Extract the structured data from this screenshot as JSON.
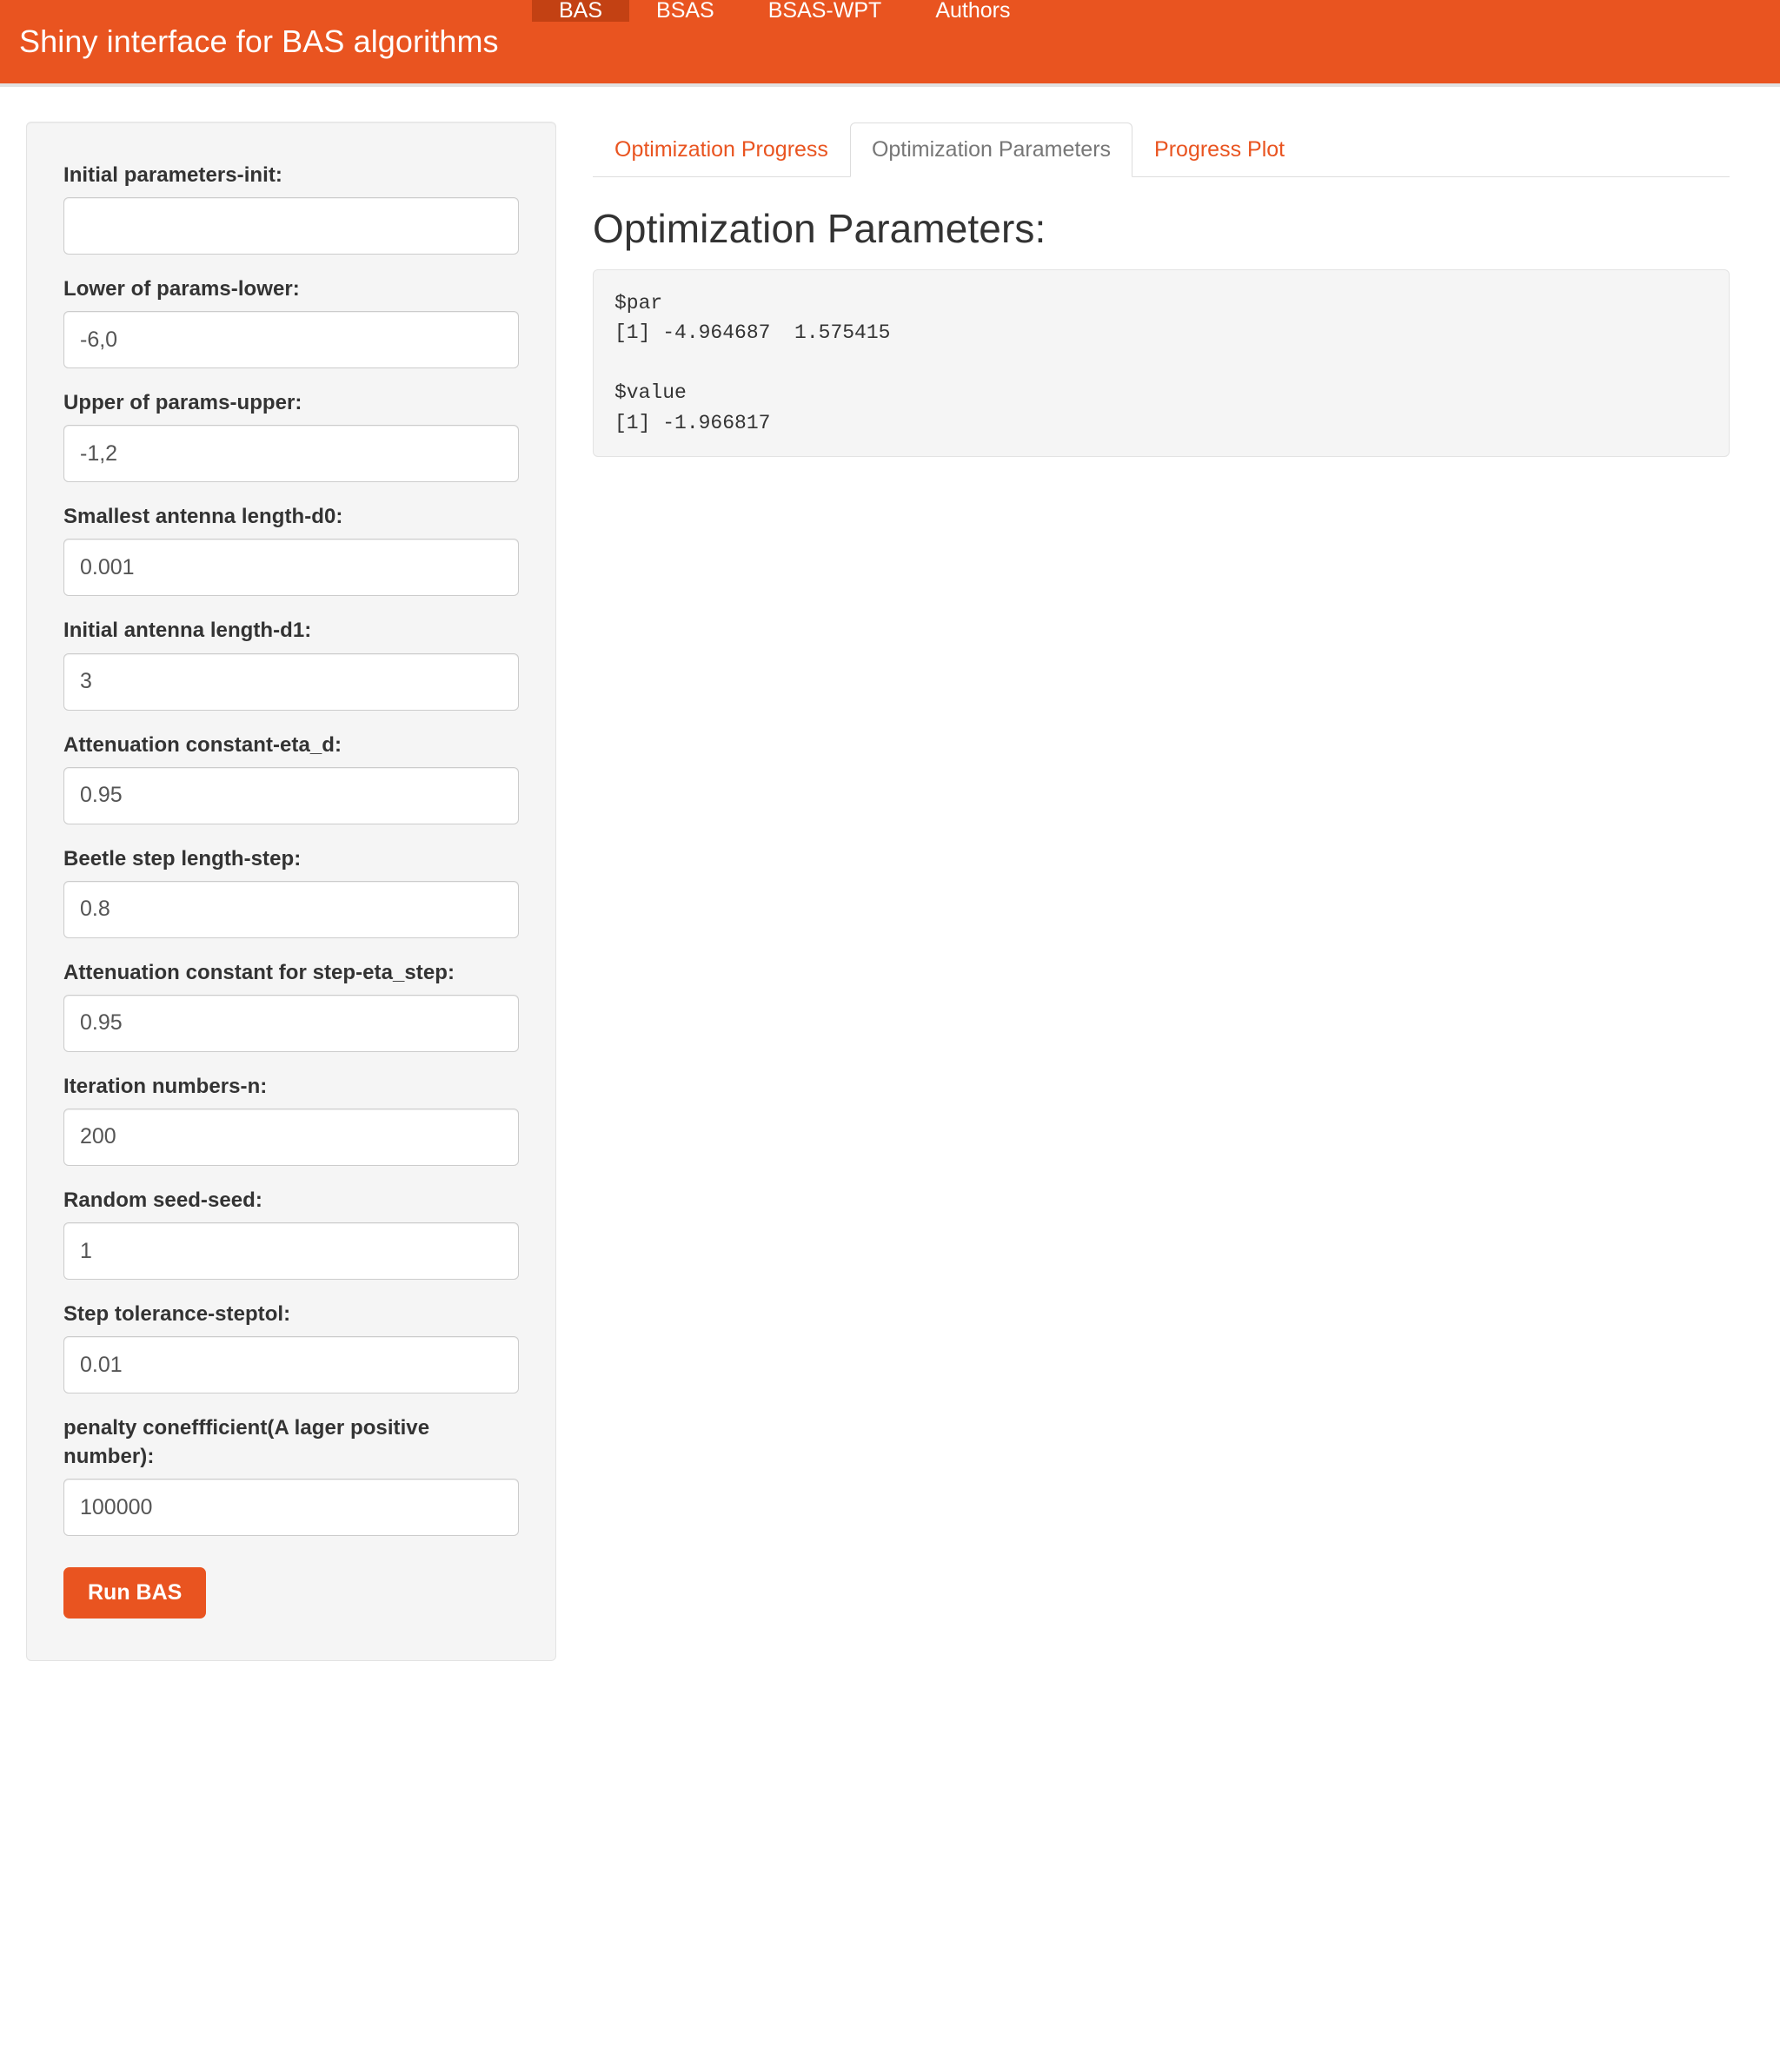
{
  "navbar": {
    "brand": "Shiny interface for BAS algorithms",
    "items": [
      {
        "label": "BAS",
        "active": true
      },
      {
        "label": "BSAS",
        "active": false
      },
      {
        "label": "BSAS-WPT",
        "active": false
      },
      {
        "label": "Authors",
        "active": false
      }
    ],
    "background_color": "#e95420",
    "active_color": "#c34113"
  },
  "sidebar": {
    "fields": [
      {
        "label": "Initial parameters-init:",
        "value": "",
        "name": "init"
      },
      {
        "label": "Lower of params-lower:",
        "value": "-6,0",
        "name": "lower"
      },
      {
        "label": "Upper of params-upper:",
        "value": "-1,2",
        "name": "upper"
      },
      {
        "label": "Smallest antenna length-d0:",
        "value": "0.001",
        "name": "d0"
      },
      {
        "label": "Initial antenna length-d1:",
        "value": "3",
        "name": "d1"
      },
      {
        "label": "Attenuation constant-eta_d:",
        "value": "0.95",
        "name": "eta-d"
      },
      {
        "label": "Beetle step length-step:",
        "value": "0.8",
        "name": "step"
      },
      {
        "label": "Attenuation constant for step-eta_step:",
        "value": "0.95",
        "name": "eta-step"
      },
      {
        "label": "Iteration numbers-n:",
        "value": "200",
        "name": "n"
      },
      {
        "label": "Random seed-seed:",
        "value": "1",
        "name": "seed"
      },
      {
        "label": "Step tolerance-steptol:",
        "value": "0.01",
        "name": "steptol"
      },
      {
        "label": "penalty coneffficient(A lager positive number):",
        "value": "100000",
        "name": "penalty"
      }
    ],
    "run_button": "Run BAS"
  },
  "main": {
    "tabs": [
      {
        "label": "Optimization Progress",
        "active": false
      },
      {
        "label": "Optimization Parameters",
        "active": true
      },
      {
        "label": "Progress Plot",
        "active": false
      }
    ],
    "panel_title": "Optimization Parameters:",
    "verbatim_output": "$par\n[1] -4.964687  1.575415\n\n$value\n[1] -1.966817"
  }
}
